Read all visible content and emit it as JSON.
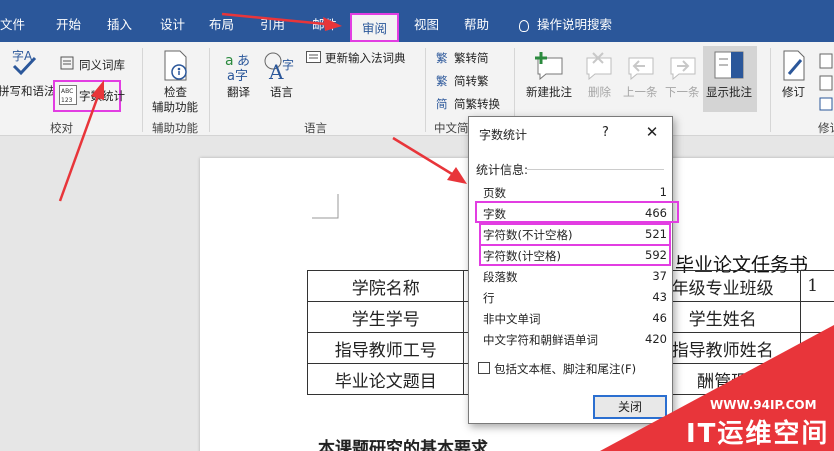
{
  "tabs": [
    {
      "label": "文件"
    },
    {
      "label": "开始"
    },
    {
      "label": "插入"
    },
    {
      "label": "设计"
    },
    {
      "label": "布局"
    },
    {
      "label": "引用"
    },
    {
      "label": "邮件"
    },
    {
      "label": "审阅",
      "active": true
    },
    {
      "label": "视图"
    },
    {
      "label": "帮助"
    }
  ],
  "tell_me": "操作说明搜索",
  "ribbon": {
    "spelling_label": "拼写和语法",
    "thesaurus_label": "同义词库",
    "word_count_label": "字数统计",
    "proofing_group": "校对",
    "check_label_1": "检查",
    "check_label_2": "辅助功能",
    "accessibility_group": "辅助功能",
    "translate_label": "翻译",
    "language_label": "语言",
    "update_ime_label": "更新输入法词典",
    "language_group": "语言",
    "trad_label": "繁转简",
    "simp_label": "简转繁",
    "convert_label": "简繁转换",
    "chinese_group": "中文简",
    "new_comment_label": "新建批注",
    "delete_label": "删除",
    "prev_label": "上一条",
    "next_label": "下一条",
    "show_comments_label": "显示批注",
    "revise_label": "修订",
    "revise_group": "修订"
  },
  "document": {
    "title": "毕业论文任务书",
    "rows": [
      [
        "学院名称",
        "",
        "年级专业班级",
        "1"
      ],
      [
        "学生学号",
        "",
        "学生姓名",
        ""
      ],
      [
        "指导教师工号",
        "",
        "指导教师姓名",
        ""
      ],
      [
        "毕业论文题目",
        "",
        "酬管理",
        ""
      ]
    ],
    "paragraph": "本课题研究的基本要求"
  },
  "dialog": {
    "title": "字数统计",
    "help": "?",
    "close_x": "✕",
    "section": "统计信息:",
    "stats": [
      {
        "label": "页数",
        "value": "1"
      },
      {
        "label": "字数",
        "value": "466"
      },
      {
        "label": "字符数(不计空格)",
        "value": "521"
      },
      {
        "label": "字符数(计空格)",
        "value": "592"
      },
      {
        "label": "段落数",
        "value": "37"
      },
      {
        "label": "行",
        "value": "43"
      },
      {
        "label": "非中文单词",
        "value": "46"
      },
      {
        "label": "中文字符和朝鲜语单词",
        "value": "420"
      }
    ],
    "checkbox_label": "包括文本框、脚注和尾注(F)",
    "close_button": "关闭"
  },
  "watermark": {
    "url": "WWW.94IP.COM",
    "text": "IT运维空间"
  },
  "colors": {
    "accent": "#2b579a",
    "highlight": "#e23de2",
    "arrow": "#e8353a"
  }
}
